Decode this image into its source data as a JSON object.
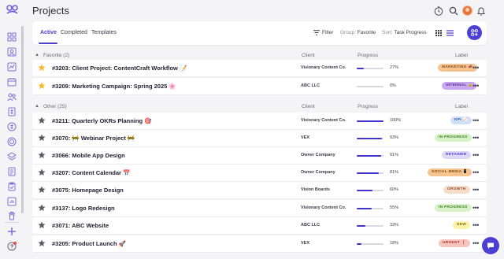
{
  "header": {
    "title": "Projects"
  },
  "toolbar": {
    "tabs": [
      "Active",
      "Completed",
      "Templates"
    ],
    "filter_label": "Filter",
    "group_label": "Group:",
    "group_value": "Favorite",
    "sort_label": "Sort:",
    "sort_value": "Task Progress"
  },
  "columns": {
    "client": "Client",
    "progress": "Progress",
    "label": "Label"
  },
  "groups": [
    {
      "name": "Favorite (2)",
      "rows": [
        {
          "title": "#3203: Client Project: ContentCraft Workflow 📝",
          "client": "Visionary Content Co.",
          "progress": 27,
          "progress_text": "27%",
          "label": "MARKETING 📣",
          "favorite": true
        },
        {
          "title": "#3209: Marketing Campaign: Spring 2025 🌸",
          "client": "ABC LLC",
          "progress": 0,
          "progress_text": "0%",
          "label": "INTERNAL 🔒",
          "favorite": true
        }
      ]
    },
    {
      "name": "Other (25)",
      "rows": [
        {
          "title": "#3211: Quarterly OKRs Planning 🎯",
          "client": "Visionary Content Co.",
          "progress": 100,
          "progress_text": "100%",
          "label": "KPI 📈",
          "favorite": false
        },
        {
          "title": "#3070: 🚧 Webinar Project 🚧",
          "client": "VEX",
          "progress": 93,
          "progress_text": "93%",
          "label": "IN PROGRESS",
          "favorite": false
        },
        {
          "title": "#3066: Mobile App Design",
          "client": "Owner Company",
          "progress": 91,
          "progress_text": "91%",
          "label": "RETAINER",
          "favorite": false
        },
        {
          "title": "#3207: Content Calendar 📅",
          "client": "Owner Company",
          "progress": 81,
          "progress_text": "81%",
          "label": "SOCIAL MEDIA 📱",
          "favorite": false
        },
        {
          "title": "#3075: Homepage Design",
          "client": "Vision Boards",
          "progress": 60,
          "progress_text": "60%",
          "label": "GROWTH",
          "favorite": false
        },
        {
          "title": "#3137: Logo Redesign",
          "client": "Visionary Content Co.",
          "progress": 55,
          "progress_text": "55%",
          "label": "IN PROGRESS",
          "favorite": false
        },
        {
          "title": "#3071: ABC Website",
          "client": "ABC LLC",
          "progress": 33,
          "progress_text": "33%",
          "label": "NEW",
          "favorite": false
        },
        {
          "title": "#3205: Product Launch 🚀",
          "client": "VEX",
          "progress": 18,
          "progress_text": "18%",
          "label": "URGENT ❗",
          "favorite": false
        }
      ]
    }
  ],
  "colors": {
    "accent": "#4b3fd4",
    "progress_fill": "#3f33c8",
    "star_favorite": "#f5b82e",
    "star_default": "#5a5a66",
    "badge_marketing": "#f5c490",
    "badge_internal": "#c9a8f0",
    "badge_kpi": "#cfe0f7",
    "badge_in_progress": "#d8f2c8",
    "badge_retainer": "#dcd6f7",
    "badge_social": "#f5c490",
    "badge_growth": "#f7dccb",
    "badge_new": "#fbf2a8",
    "badge_urgent": "#f7c4c0"
  },
  "icons": {
    "sidebar": [
      "dashboard-icon",
      "contacts-icon",
      "analytics-icon",
      "calendar-icon",
      "team-icon",
      "invoices-icon",
      "billing-icon",
      "target-icon",
      "layers-icon",
      "timesheet-icon",
      "tasks-icon",
      "reports-icon",
      "trash-icon",
      "collapse-icon",
      "add-icon",
      "help-icon"
    ],
    "header": [
      "timer-icon",
      "search-icon",
      "avatar",
      "bell-icon"
    ]
  }
}
